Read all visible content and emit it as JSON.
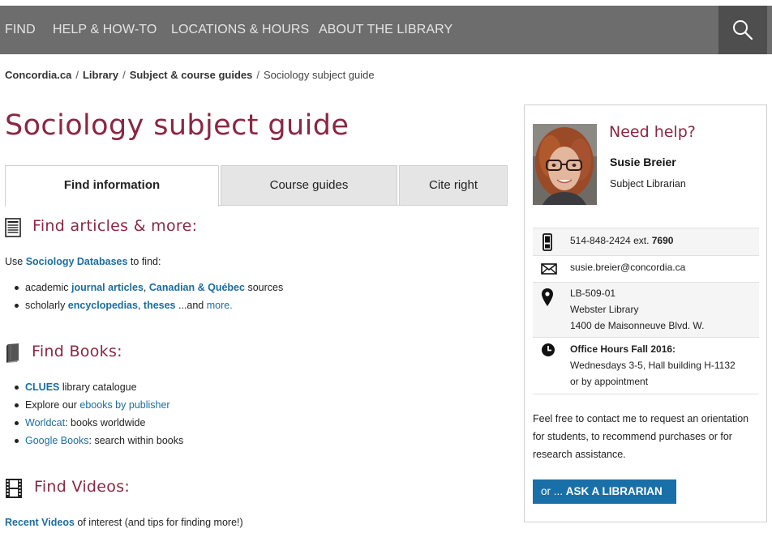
{
  "nav": {
    "items": [
      "FIND",
      "HELP & HOW-TO",
      "LOCATIONS & HOURS",
      "ABOUT THE LIBRARY"
    ],
    "search_icon": "magnifier-icon"
  },
  "breadcrumb": {
    "items": [
      "Concordia.ca",
      "Library",
      "Subject & course guides"
    ],
    "current": "Sociology subject guide",
    "separator": "/"
  },
  "page": {
    "title": "Sociology subject guide"
  },
  "tabs": [
    "Find information",
    "Course guides",
    "Cite right"
  ],
  "sections": {
    "articles": {
      "heading": "Find articles & more:",
      "icon": "newspaper-icon",
      "intro_prefix": "Use ",
      "intro_link": "Sociology Databases",
      "intro_suffix": " to find:",
      "bullet1": {
        "prefix": "academic ",
        "link1": "journal articles",
        "comma": ", ",
        "link2": "Canadian & Québec",
        "suffix": " sources"
      },
      "bullet2": {
        "prefix": "scholarly ",
        "link1": "encyclopedias",
        "comma": ", ",
        "link2": "theses",
        "mid": " ...and ",
        "link3": "more."
      }
    },
    "books": {
      "heading": "Find Books:",
      "icon": "book-icon",
      "items": [
        {
          "link": "CLUES",
          "bold": true,
          "prefix": "",
          "suffix": " library catalogue"
        },
        {
          "link": "ebooks by publisher",
          "bold": false,
          "prefix": "Explore our ",
          "suffix": ""
        },
        {
          "link": "Worldcat",
          "bold": false,
          "prefix": "",
          "suffix": ": books worldwide"
        },
        {
          "link": "Google Books",
          "bold": false,
          "prefix": "",
          "suffix": ": search within books"
        }
      ]
    },
    "videos": {
      "heading": "Find Videos:",
      "icon": "film-icon",
      "link": "Recent Videos",
      "suffix": " of interest (and tips for finding more!)"
    }
  },
  "sidebar": {
    "heading": "Need help?",
    "name": "Susie Breier",
    "role": "Subject Librarian",
    "phone": {
      "number": "514-848-2424 ext. ",
      "ext": "7690",
      "icon": "phone-icon"
    },
    "email": {
      "address": "susie.breier@concordia.ca",
      "icon": "envelope-icon"
    },
    "location": {
      "lines": [
        "LB-509-01",
        "Webster Library",
        "1400 de Maisonneuve Blvd. W."
      ],
      "icon": "map-pin-icon"
    },
    "hours": {
      "title": "Office Hours Fall 2016:",
      "lines": [
        "Wednesdays 3-5, Hall building H-1132",
        "or by appointment"
      ],
      "icon": "clock-icon"
    },
    "contact_note": "Feel free to contact me to request an orientation for students, to recommend purchases or for research assistance.",
    "ask_prefix": "or ... ",
    "ask_label": "ASK A LIBRARIAN"
  },
  "colors": {
    "nav_bg": "#6d6d6d",
    "search_bg": "#4e4e4e",
    "accent": "#8a2743",
    "link": "#1b6d9e",
    "button": "#1970a8"
  }
}
